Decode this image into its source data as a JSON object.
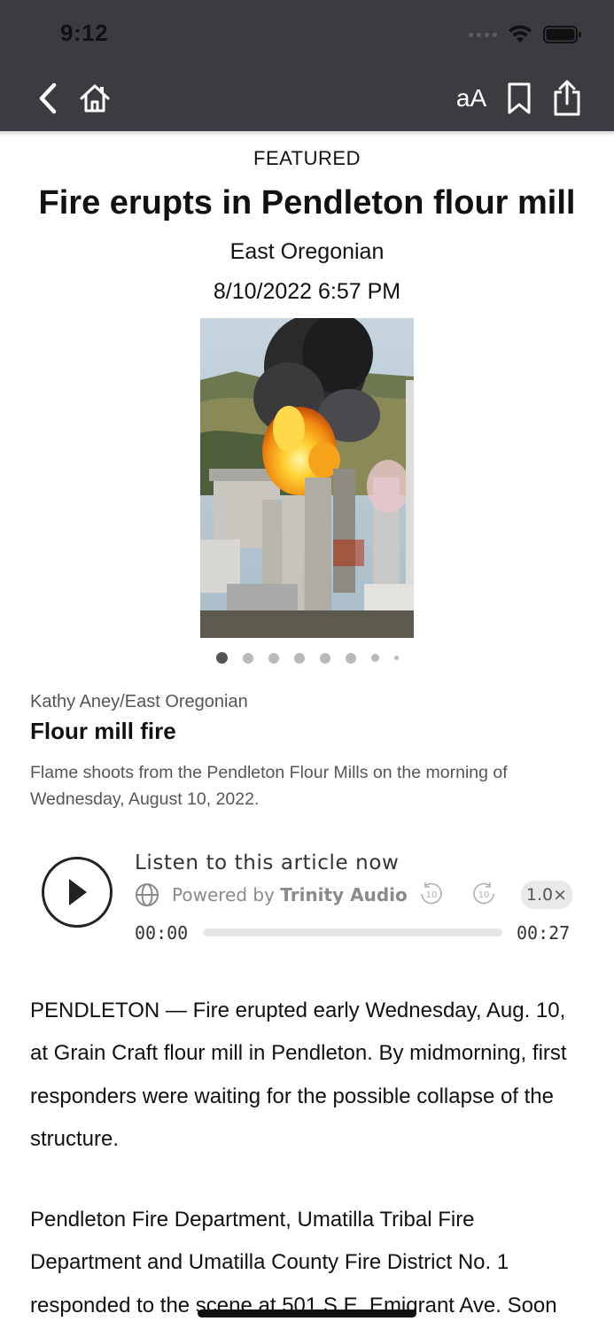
{
  "status_bar": {
    "time": "9:12",
    "icons": [
      "cellular-signal-icon",
      "wifi-icon",
      "battery-icon"
    ]
  },
  "nav": {
    "icons": [
      "back-chevron-icon",
      "home-icon",
      "bookmark-icon",
      "share-icon"
    ],
    "text_size_label": "aA"
  },
  "article": {
    "kicker": "FEATURED",
    "title": "Fire erupts in Pendleton flour mill",
    "source": "East Oregonian",
    "date": "8/10/2022 6:57 PM",
    "photo": {
      "credit": "Kathy Aney/East Oregonian",
      "title": "Flour mill fire",
      "caption": "Flame shoots from the Pendleton Flour Mills on the morning of Wednesday, August 10, 2022.",
      "gallery_count": 8,
      "gallery_index": 1
    },
    "paragraphs": [
      "PENDLETON — Fire erupted early Wednesday, Aug. 10, at Grain Craft flour mill in Pendleton. By midmorning, first responders were waiting for the possible collapse of the structure.",
      "Pendleton Fire Department, Umatilla Tribal Fire Department and Umatilla County Fire District No. 1 responded to the scene at 501 S.E. Emigrant Ave. Soon"
    ]
  },
  "audio": {
    "heading": "Listen to this article now",
    "powered_prefix": "Powered by",
    "powered_brand": "Trinity Audio",
    "skip_back_label": "10",
    "skip_forward_label": "10",
    "speed": "1.0×",
    "current_time": "00:00",
    "duration": "00:27",
    "progress": 0
  },
  "colors": {
    "top_bar": "#3b3c41",
    "text": "#111111",
    "muted": "#555555"
  }
}
